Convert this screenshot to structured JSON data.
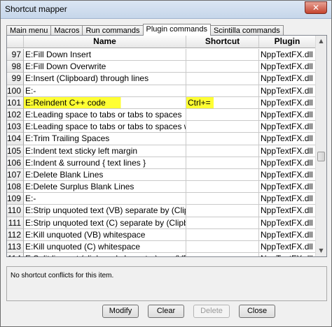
{
  "window": {
    "title": "Shortcut mapper",
    "close_glyph": "✕"
  },
  "tabs": [
    {
      "label": "Main menu"
    },
    {
      "label": "Macros"
    },
    {
      "label": "Run commands"
    },
    {
      "label": "Plugin commands",
      "active": true
    },
    {
      "label": "Scintilla commands"
    }
  ],
  "table": {
    "headers": {
      "name": "Name",
      "shortcut": "Shortcut",
      "plugin": "Plugin"
    },
    "rows": [
      {
        "num": "97",
        "name": "E:Fill Down Insert",
        "shortcut": "",
        "plugin": "NppTextFX.dll"
      },
      {
        "num": "98",
        "name": "E:Fill Down Overwrite",
        "shortcut": "",
        "plugin": "NppTextFX.dll"
      },
      {
        "num": "99",
        "name": "E:Insert (Clipboard) through lines",
        "shortcut": "",
        "plugin": "NppTextFX.dll"
      },
      {
        "num": "100",
        "name": "E:-",
        "shortcut": "",
        "plugin": "NppTextFX.dll"
      },
      {
        "num": "101",
        "name": "E:Reindent C++ code",
        "shortcut": "Ctrl+=",
        "plugin": "NppTextFX.dll",
        "highlight": true
      },
      {
        "num": "102",
        "name": "E:Leading space to tabs or tabs to spaces",
        "shortcut": "",
        "plugin": "NppTextFX.dll"
      },
      {
        "num": "103",
        "name": "E:Leading space to tabs or tabs to spaces widt...",
        "shortcut": "",
        "plugin": "NppTextFX.dll"
      },
      {
        "num": "104",
        "name": "E:Trim Trailing Spaces",
        "shortcut": "",
        "plugin": "NppTextFX.dll"
      },
      {
        "num": "105",
        "name": "E:Indent text sticky left margin",
        "shortcut": "",
        "plugin": "NppTextFX.dll"
      },
      {
        "num": "106",
        "name": "E:Indent & surround { text lines }",
        "shortcut": "",
        "plugin": "NppTextFX.dll"
      },
      {
        "num": "107",
        "name": "E:Delete Blank Lines",
        "shortcut": "",
        "plugin": "NppTextFX.dll"
      },
      {
        "num": "108",
        "name": "E:Delete Surplus Blank Lines",
        "shortcut": "",
        "plugin": "NppTextFX.dll"
      },
      {
        "num": "109",
        "name": "E:-",
        "shortcut": "",
        "plugin": "NppTextFX.dll"
      },
      {
        "num": "110",
        "name": "E:Strip unquoted text (VB) separate by (Clipbo...",
        "shortcut": "",
        "plugin": "NppTextFX.dll"
      },
      {
        "num": "111",
        "name": "E:Strip unquoted text (C) separate by (Clipboar...",
        "shortcut": "",
        "plugin": "NppTextFX.dll"
      },
      {
        "num": "112",
        "name": "E:Kill unquoted (VB) whitespace",
        "shortcut": "",
        "plugin": "NppTextFX.dll"
      },
      {
        "num": "113",
        "name": "E:Kill unquoted (C) whitespace",
        "shortcut": "",
        "plugin": "NppTextFX.dll"
      },
      {
        "num": "114",
        "name": "E:Split lines at (clipboard character) or , (VB)",
        "shortcut": "",
        "plugin": "NppTextFX.dll"
      }
    ]
  },
  "scrollbar": {
    "up_glyph": "▲",
    "down_glyph": "▼"
  },
  "info": {
    "message": "No shortcut conflicts for this item."
  },
  "buttons": {
    "modify": "Modify",
    "clear": "Clear",
    "delete": "Delete",
    "close": "Close"
  },
  "colors": {
    "highlight": "#ffff33"
  }
}
